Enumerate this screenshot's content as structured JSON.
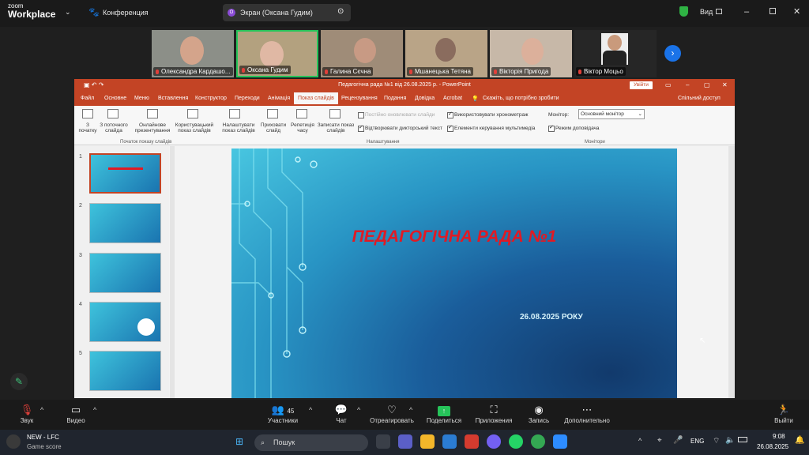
{
  "app": {
    "logo_top": "zoom",
    "logo_bottom": "Workplace",
    "conference": "Конференция",
    "screen_tab": "Экран (Оксана Гудим)",
    "view": "Вид"
  },
  "participants": [
    {
      "name": "Олександра Кардашо..."
    },
    {
      "name": "Оксана Гудим"
    },
    {
      "name": "Галина Сєчна"
    },
    {
      "name": "Мшанецька Тетяна"
    },
    {
      "name": "Вікторія Пригода"
    },
    {
      "name": "Віктор Моцьо"
    }
  ],
  "ppt": {
    "title": "Педагогічна рада №1 від 26.08.2025 р.  -  PowerPoint",
    "signin": "Увійти",
    "tabs": [
      "Файл",
      "Основне",
      "Меню",
      "Вставлення",
      "Конструктор",
      "Переходи",
      "Анімація",
      "Показ слайдів",
      "Рецензування",
      "Подання",
      "Довідка",
      "Acrobat"
    ],
    "tellme": "Скажіть, що потрібно зробити",
    "share": "Спільний доступ",
    "ribbon": {
      "from_start": "З початку",
      "from_current": "З поточного слайда",
      "online": "Онлайнове презентування",
      "custom": "Користувацький показ слайдів",
      "setup": "Налаштувати показ слайдів",
      "hide": "Приховати слайд",
      "rehearse": "Репетиція часу",
      "record": "Записати показ слайдів",
      "cb_update": "Постійно оновлювати слайди",
      "cb_narration": "Відтворювати дикторський текст",
      "cb_timings": "Використовувати хронометраж",
      "cb_media": "Елементи керування мультимедіа",
      "monitor_label": "Монітор:",
      "monitor_value": "Основний монітор",
      "presenter": "Режим доповідача",
      "grp_start": "Початок показу слайдів",
      "grp_setup": "Налаштування",
      "grp_monitors": "Монітори"
    },
    "slide_numbers": [
      "1",
      "2",
      "3",
      "4",
      "5"
    ],
    "slide_title": "ПЕДАГОГІЧНА РАДА №1",
    "slide_date": "26.08.2025 РОКУ"
  },
  "toolbar": {
    "sound": "Звук",
    "video": "Видео",
    "participants": "Участники",
    "participants_count": "45",
    "chat": "Чат",
    "react": "Отреагировать",
    "share": "Поделиться",
    "apps": "Приложения",
    "record": "Запись",
    "more": "Дополнительно",
    "leave": "Выйти"
  },
  "taskbar": {
    "news_title": "NEW - LFC",
    "news_sub": "Game score",
    "search": "Пошук",
    "lang": "ENG",
    "time": "9:08",
    "date": "26.08.2025"
  }
}
